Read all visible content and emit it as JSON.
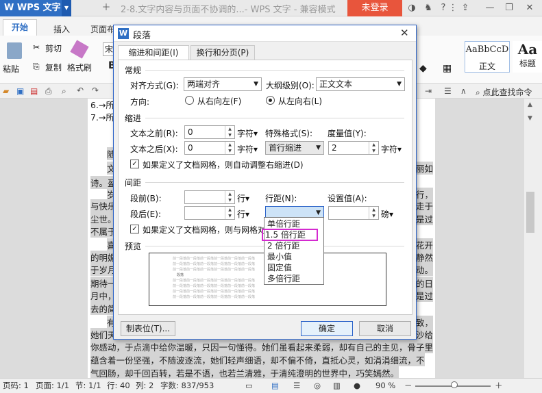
{
  "app": {
    "name": "WPS 文字",
    "doc_title": "2-8.文字内容与页面不协调的...- WPS 文字 - 兼容模式",
    "login_label": "未登录"
  },
  "ribbon_tabs": [
    "开始",
    "插入",
    "页面布"
  ],
  "ribbon": {
    "paste": "粘贴",
    "cut": "剪切",
    "copy": "复制",
    "format_painter": "格式刷",
    "font_name": "宋",
    "style_sample1": "AaBbCcD",
    "style_label1": "正文",
    "style_sample2": "Aa",
    "style_label2": "标题",
    "find_cmd": "点此查找命令"
  },
  "document": {
    "lines": [
      "6.→所",
      "7.→所",
      "随",
      "文",
      "诗。盈",
      "岁",
      "与快乐",
      "尘世。",
      "不属于",
      "喜",
      "的明媚",
      "于岁月",
      "期待一",
      "月中，",
      "去的简",
      "有",
      "她们天",
      "你感动，于点滴中给你温暖，只因一句懂得。她们虽看起来柔弱，却有自己的主见，骨子里",
      "蕴含着一份坚强，不随波逐流，她们轻声细语，却不偏不倚，直抵心灵，如涓涓细流，不",
      "气回肠，却千回百转，若是不语，也若兰清雅，于清纯澄明的世界中，巧笑嫣然。"
    ],
    "right_fragments": [
      "丽如",
      "行，",
      "走于",
      "是过",
      "花开",
      "静然",
      "动。",
      "的日",
      "是过",
      "致，",
      "沙给"
    ]
  },
  "status": {
    "page_code": "页码: 1",
    "pages": "页面: 1/1",
    "section": "节: 1/1",
    "row": "行: 40",
    "col": "列: 2",
    "words": "字数: 837/953",
    "zoom": "90 %"
  },
  "dialog": {
    "title": "段落",
    "tabs": [
      "缩进和间距(I)",
      "换行和分页(P)"
    ],
    "general": {
      "section": "常规",
      "align_label": "对齐方式(G):",
      "align_value": "两端对齐",
      "outline_label": "大纲级别(O):",
      "outline_value": "正文文本",
      "direction_label": "方向:",
      "rtl": "从右向左(F)",
      "ltr": "从左向右(L)"
    },
    "indent": {
      "section": "缩进",
      "before_label": "文本之前(R):",
      "before_value": "0",
      "before_unit": "字符",
      "after_label": "文本之后(X):",
      "after_value": "0",
      "after_unit": "字符",
      "special_label": "特殊格式(S):",
      "special_value": "首行缩进",
      "measure_label": "度量值(Y):",
      "measure_value": "2",
      "measure_unit": "字符",
      "grid_check": "如果定义了文档网格，则自动调整右缩进(D)"
    },
    "spacing": {
      "section": "间距",
      "before_label": "段前(B):",
      "before_value": "",
      "before_unit": "行",
      "after_label": "段后(E):",
      "after_value": "",
      "after_unit": "行",
      "line_label": "行距(N):",
      "line_value": "",
      "setting_label": "设置值(A):",
      "setting_value": "",
      "setting_unit": "磅",
      "grid_check": "如果定义了文档网格，则与网格对"
    },
    "preview": {
      "section": "预览",
      "sample": "前一段落前一段落前一段落前一段落前一段落前一段落",
      "current": "段落"
    },
    "tabs_button": "制表位(T)...",
    "ok": "确定",
    "cancel": "取消"
  },
  "line_spacing_options": [
    "单倍行距",
    "1.5 倍行距",
    "2 倍行距",
    "最小值",
    "固定值",
    "多倍行距"
  ],
  "colors": {
    "accent": "#2f6fc4",
    "login": "#e8553c",
    "highlight_option": "#d42ad0"
  }
}
